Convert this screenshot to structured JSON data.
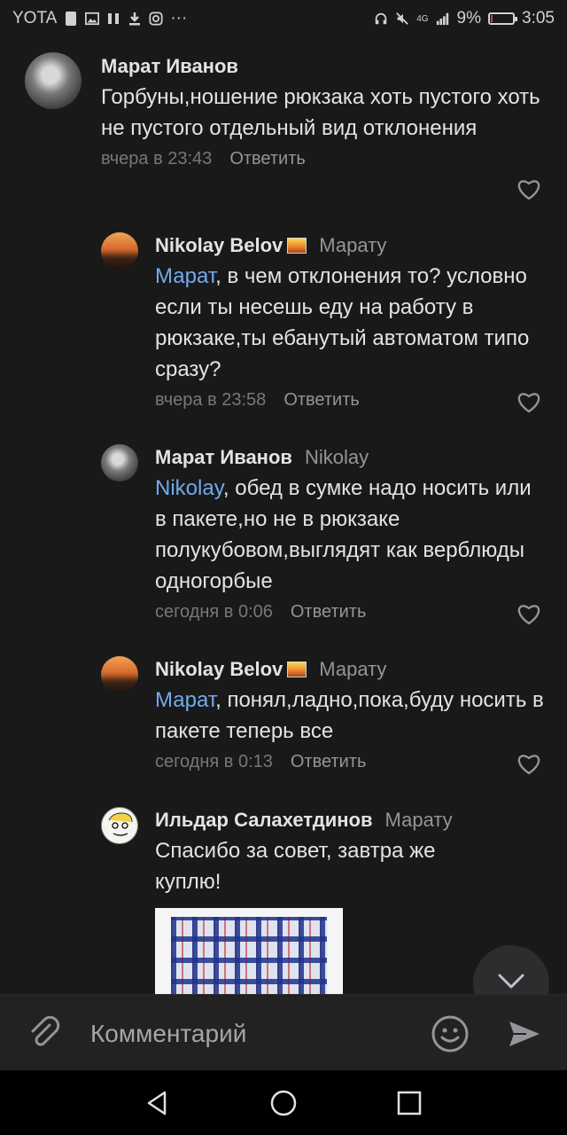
{
  "status": {
    "carrier": "YOTA",
    "dots": "···",
    "network": "4G",
    "battery_percent": 9,
    "battery_text": "9%",
    "time": "3:05"
  },
  "comments": [
    {
      "author": "Марат Иванов",
      "reply_to": "",
      "mention": "",
      "text": "Горбуны,ношение рюкзака хоть пустого хоть не пустого отдельный вид отклонения",
      "time": "вчера в 23:43",
      "reply_label": "Ответить",
      "avatar_icon": "rifle-avatar"
    },
    {
      "author": "Nikolay Belov",
      "reply_to": "Марату",
      "mention": "Марат",
      "text": ", в чем отклонения то? условно если ты несешь еду на работу в рюкзаке,ты ебанутый автоматом типо сразу?",
      "time": "вчера в 23:58",
      "reply_label": "Ответить",
      "avatar_icon": "sunset-avatar"
    },
    {
      "author": "Марат Иванов",
      "reply_to": "Nikolay",
      "mention": "Nikolay",
      "text": ", обед в сумке надо носить или в пакете,но не в рюкзаке полукубовом,выглядят как верблюды одногорбые",
      "time": "сегодня в 0:06",
      "reply_label": "Ответить",
      "avatar_icon": "rifle-avatar"
    },
    {
      "author": "Nikolay Belov",
      "reply_to": "Марату",
      "mention": "Марат",
      "text": ", понял,ладно,пока,буду носить в пакете теперь все",
      "time": "сегодня в 0:13",
      "reply_label": "Ответить",
      "avatar_icon": "sunset-avatar"
    },
    {
      "author": "Ильдар Салахетдинов",
      "reply_to": "Марату",
      "mention": "",
      "text": "Спасибо за совет, завтра же куплю!",
      "time": "",
      "reply_label": "",
      "avatar_icon": "meme-face-avatar",
      "attachment": "plaid-bag-photo"
    }
  ],
  "composer": {
    "placeholder": "Комментарий"
  },
  "colors": {
    "background": "#19191a",
    "mention": "#71aaeb",
    "meta": "#76787a",
    "battery_low": "#e03b3b"
  }
}
